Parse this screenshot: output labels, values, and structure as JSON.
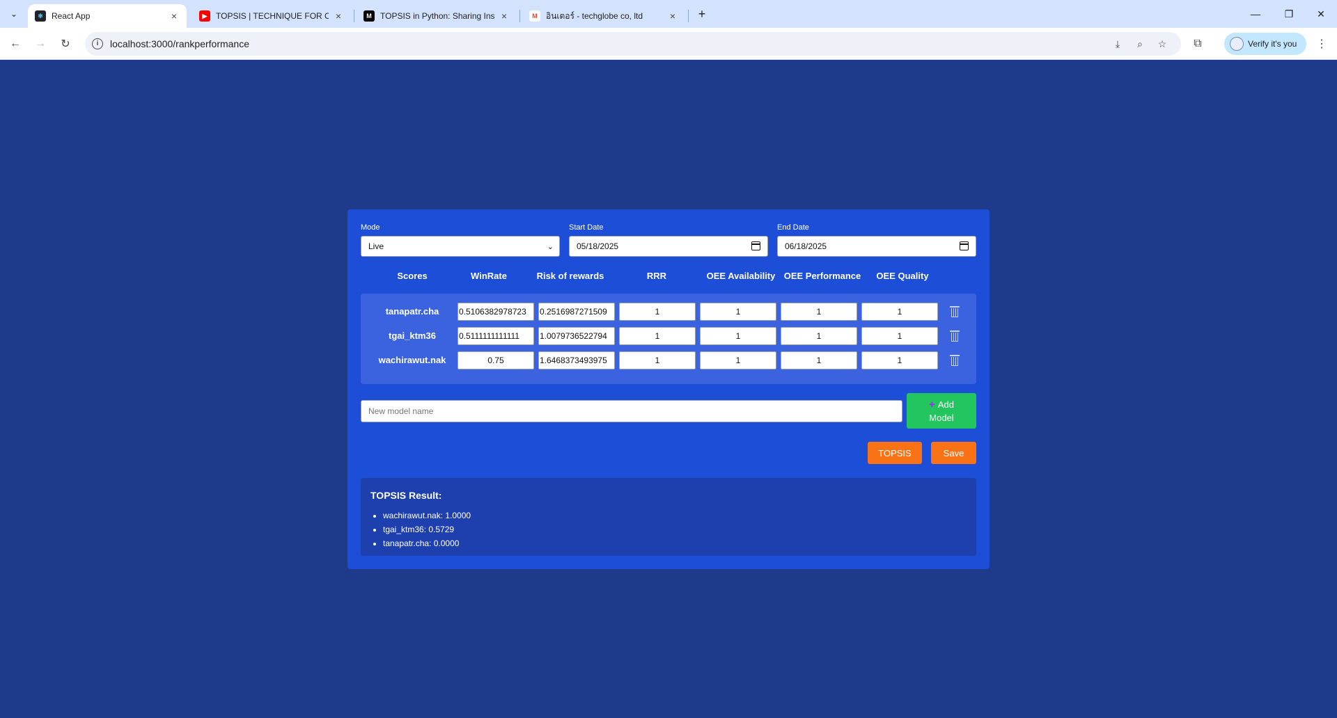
{
  "browser": {
    "tabs": [
      {
        "title": "React App",
        "close": "×"
      },
      {
        "title": "TOPSIS | TECHNIQUE FOR ORDE",
        "close": "×"
      },
      {
        "title": "TOPSIS in Python: Sharing Insig",
        "close": "×"
      },
      {
        "title": "อินเตอร์ - techglobe co, ltd",
        "close": "×"
      }
    ],
    "url": "localhost:3000/rankperformance",
    "profile_label": "Verify it's you"
  },
  "form": {
    "mode_label": "Mode",
    "mode_value": "Live",
    "start_label": "Start Date",
    "start_value": "05/18/2025",
    "end_label": "End Date",
    "end_value": "06/18/2025"
  },
  "table": {
    "headers": [
      "Scores",
      "WinRate",
      "Risk of rewards",
      "RRR",
      "OEE Availability",
      "OEE Performance",
      "OEE Quality"
    ],
    "rows": [
      {
        "name": "tanapatr.cha",
        "values": [
          "0.5106382978723",
          "0.2516987271509",
          "1",
          "1",
          "1",
          "1"
        ]
      },
      {
        "name": "tgai_ktm36",
        "values": [
          "0.5111111111111",
          "1.0079736522794",
          "1",
          "1",
          "1",
          "1"
        ]
      },
      {
        "name": "wachirawut.nak",
        "values": [
          "0.75",
          "1.6468373493975",
          "1",
          "1",
          "1",
          "1"
        ]
      }
    ]
  },
  "new_model": {
    "placeholder": "New model name"
  },
  "buttons": {
    "add_line1": "Add",
    "add_line2": "Model",
    "topsis": "TOPSIS",
    "save": "Save"
  },
  "result": {
    "title": "TOPSIS Result:",
    "items": [
      "wachirawut.nak: 1.0000",
      "tgai_ktm36: 0.5729",
      "tanapatr.cha: 0.0000"
    ]
  },
  "colors": {
    "page_bg": "#1e3a8a",
    "card_bg": "#1d4ed8",
    "table_panel": "#3b63e0",
    "result_bg": "#1e40af",
    "add_button": "#22c55e",
    "action_button": "#f97316"
  }
}
